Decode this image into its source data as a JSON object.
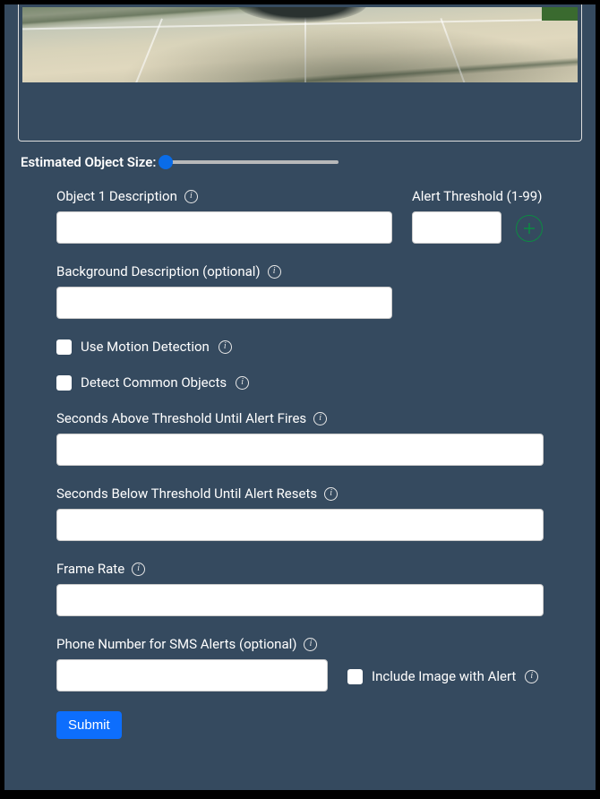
{
  "slider_label": "Estimated Object Size:",
  "object": {
    "desc_label": "Object 1 Description",
    "thresh_label": "Alert Threshold (1-99)"
  },
  "background": {
    "label": "Background Description (optional)"
  },
  "motion": {
    "label": "Use Motion Detection"
  },
  "common_objects": {
    "label": "Detect Common Objects"
  },
  "fire": {
    "label": "Seconds Above Threshold Until Alert Fires"
  },
  "reset": {
    "label": "Seconds Below Threshold Until Alert Resets"
  },
  "framerate": {
    "label": "Frame Rate"
  },
  "phone": {
    "label": "Phone Number for SMS Alerts (optional)"
  },
  "include_image": {
    "label": "Include Image with Alert"
  },
  "submit": "Submit"
}
